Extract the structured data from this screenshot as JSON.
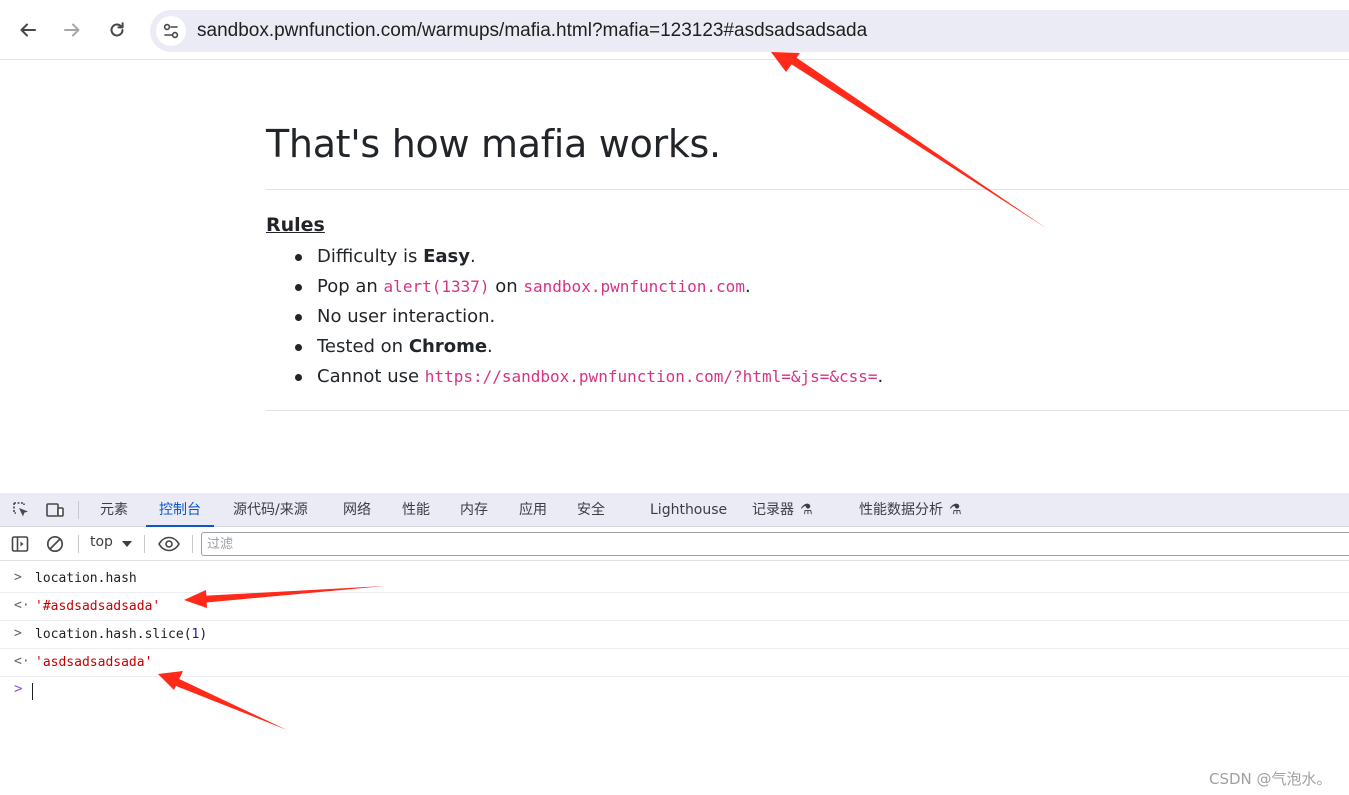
{
  "browser": {
    "url": "sandbox.pwnfunction.com/warmups/mafia.html?mafia=123123#asdsadsadsada",
    "back_icon": "arrow-left-icon",
    "forward_icon": "arrow-right-icon",
    "reload_icon": "reload-icon",
    "site_info_icon": "tune-icon"
  },
  "page": {
    "title": "That's how mafia works.",
    "rules_heading": "Rules",
    "rules": [
      {
        "before": "Difficulty is ",
        "bold": "Easy",
        "after": "."
      },
      {
        "before": "Pop an ",
        "code1": "alert(1337)",
        "middle": " on ",
        "code2": "sandbox.pwnfunction.com",
        "after": "."
      },
      {
        "text": "No user interaction."
      },
      {
        "before": "Tested on ",
        "bold": "Chrome",
        "after": "."
      },
      {
        "before": "Cannot use ",
        "code": "https://sandbox.pwnfunction.com/?html=&js=&css=",
        "after": "."
      }
    ]
  },
  "devtools": {
    "tabs": [
      {
        "label": "元素"
      },
      {
        "label": "控制台",
        "active": true
      },
      {
        "label": "源代码/来源"
      },
      {
        "label": "网络"
      },
      {
        "label": "性能"
      },
      {
        "label": "内存"
      },
      {
        "label": "应用"
      },
      {
        "label": "安全"
      },
      {
        "label": "Lighthouse"
      },
      {
        "label": "记录器"
      },
      {
        "label": "性能数据分析"
      }
    ],
    "context": "top",
    "filter_placeholder": "过滤",
    "console": [
      {
        "type": "input",
        "text": "location.hash"
      },
      {
        "type": "output",
        "text": "'#asdsadsadsada'"
      },
      {
        "type": "input",
        "code": "location.hash.slice(",
        "num": "1",
        "close": ")"
      },
      {
        "type": "output",
        "text": "'asdsadsadsada'"
      }
    ],
    "accent_color": "#0b57d0",
    "string_color": "#c80000"
  },
  "annotation_color": "#ff2a1a",
  "watermark": "CSDN @气泡水。"
}
